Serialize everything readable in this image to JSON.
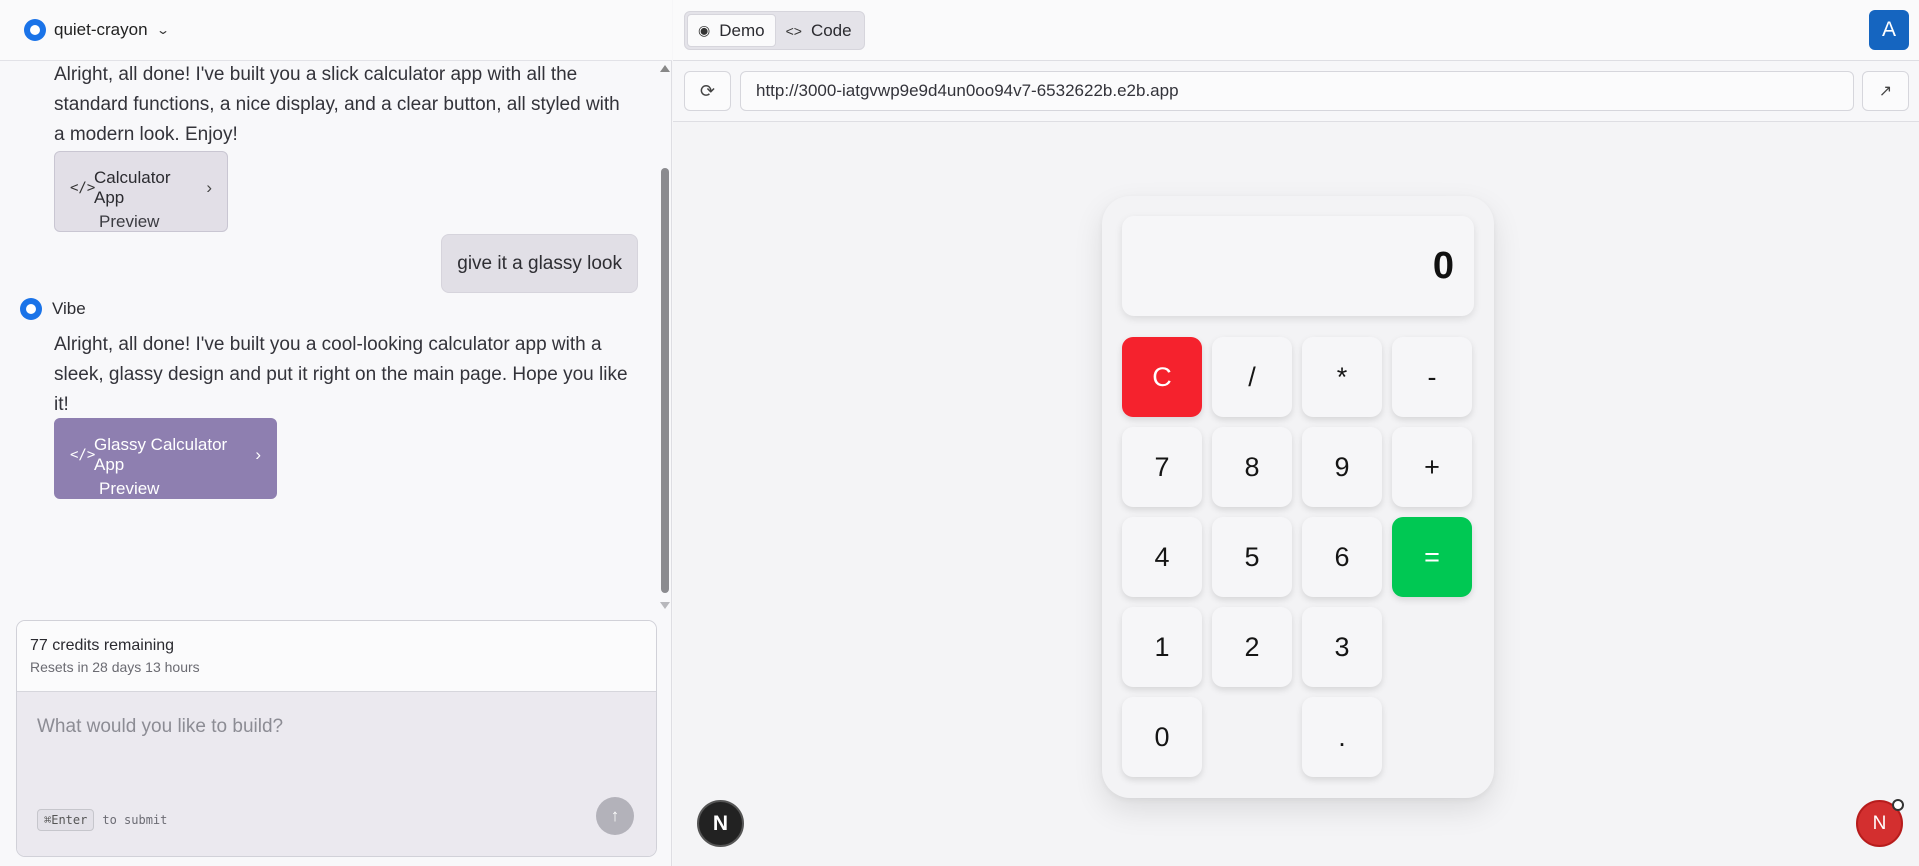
{
  "project": {
    "name": "quiet-crayon",
    "logo_icon": "vibe-logo-icon",
    "dropdown_icon": "chevron-down-icon"
  },
  "messages": {
    "first_ai_text": "Alright, all done! I've built you a slick calculator app with all the standard functions, a nice display, and a clear button, all styled with a modern look. Enjoy!",
    "first_fragment": {
      "title": "Calculator App",
      "subtitle": "Preview"
    },
    "user_message": "give it a glassy look",
    "assistant_name": "Vibe",
    "second_ai_text": "Alright, all done! I've built you a cool-looking calculator app with a sleek, glassy design and put it right on the main page. Hope you like it!",
    "second_fragment": {
      "title": "Glassy Calculator App",
      "subtitle": "Preview"
    }
  },
  "composer": {
    "credits": "77 credits remaining",
    "resets": "Resets in 28 days 13 hours",
    "placeholder": "What would you like to build?",
    "shortcut_key": "⌘Enter",
    "shortcut_hint": "to submit"
  },
  "tabs": [
    {
      "label": "Demo",
      "icon": "eye-icon",
      "active": true
    },
    {
      "label": "Code",
      "icon": "code-icon",
      "active": false
    }
  ],
  "user": {
    "avatar_letter": "A"
  },
  "browser": {
    "url": "http://3000-iatgvwp9e9d4un0oo94v7-6532622b.e2b.app"
  },
  "calculator": {
    "display": "0",
    "keys": {
      "clear": "C",
      "divide": "/",
      "multiply": "*",
      "minus": "-",
      "seven": "7",
      "eight": "8",
      "nine": "9",
      "plus": "+",
      "four": "4",
      "five": "5",
      "six": "6",
      "equals": "=",
      "one": "1",
      "two": "2",
      "three": "3",
      "zero": "0",
      "dot": "."
    },
    "colors": {
      "clear": "#f5222d",
      "equals": "#00c853"
    }
  },
  "badges": {
    "next": "N",
    "issues": "N"
  }
}
